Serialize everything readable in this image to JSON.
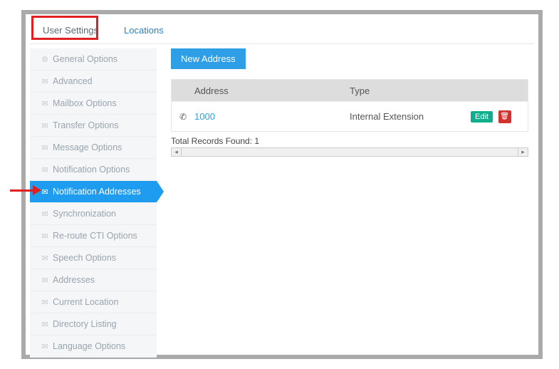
{
  "tabs": {
    "user_settings": "User Settings",
    "locations": "Locations"
  },
  "sidebar": {
    "items": [
      {
        "icon": "gear",
        "label": "General Options"
      },
      {
        "icon": "envelope",
        "label": "Advanced"
      },
      {
        "icon": "envelope",
        "label": "Mailbox Options"
      },
      {
        "icon": "envelope",
        "label": "Transfer Options"
      },
      {
        "icon": "envelope",
        "label": "Message Options"
      },
      {
        "icon": "envelope",
        "label": "Notification Options"
      },
      {
        "icon": "envelope",
        "label": "Notification Addresses",
        "active": true
      },
      {
        "icon": "envelope",
        "label": "Synchronization"
      },
      {
        "icon": "envelope",
        "label": "Re-route CTI Options"
      },
      {
        "icon": "envelope",
        "label": "Speech Options"
      },
      {
        "icon": "envelope",
        "label": "Addresses"
      },
      {
        "icon": "envelope",
        "label": "Current Location"
      },
      {
        "icon": "envelope",
        "label": "Directory Listing"
      },
      {
        "icon": "envelope",
        "label": "Language Options"
      }
    ]
  },
  "main": {
    "new_button": "New Address",
    "columns": {
      "address": "Address",
      "type": "Type"
    },
    "rows": [
      {
        "icon": "phone",
        "address": "1000",
        "type": "Internal Extension"
      }
    ],
    "edit_label": "Edit",
    "total_label": "Total Records Found:",
    "total_count": "1"
  }
}
